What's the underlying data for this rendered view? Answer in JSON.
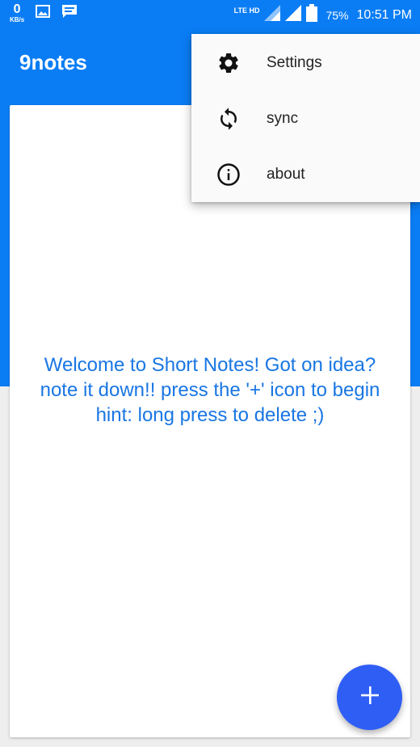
{
  "status_bar": {
    "net_speed_value": "0",
    "net_speed_unit": "KB/s",
    "network_type": "LTE HD",
    "battery_percent": "75%",
    "time": "10:51 PM"
  },
  "app_bar": {
    "title": "9notes"
  },
  "overflow_menu": {
    "items": [
      {
        "label": "Settings",
        "icon": "gear-icon"
      },
      {
        "label": "sync",
        "icon": "sync-icon"
      },
      {
        "label": "about",
        "icon": "info-icon"
      }
    ]
  },
  "main": {
    "welcome_line1": "Welcome to Short Notes! Got on idea?",
    "welcome_line2": "note it down!! press the '+' icon to begin",
    "welcome_line3": "hint: long press to delete ;)"
  },
  "fab": {
    "icon": "plus-icon"
  },
  "colors": {
    "primary": "#0a7df5",
    "fab": "#2f5ef5",
    "welcome_text": "#1976e3"
  }
}
